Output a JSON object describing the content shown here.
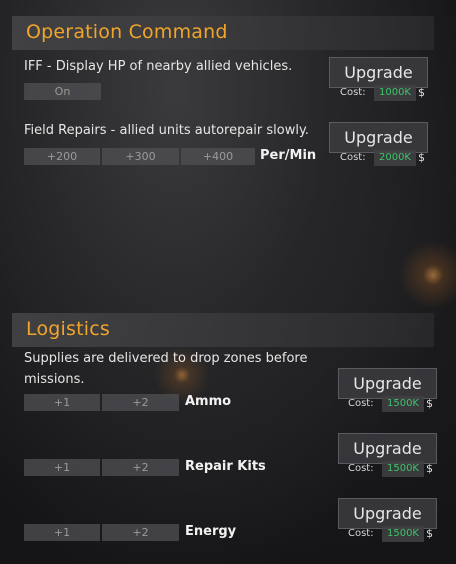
{
  "operation_command": {
    "title": "Operation Command",
    "iff": {
      "description": "IFF - Display HP of nearby allied vehicles.",
      "option": "On",
      "upgrade_label": "Upgrade",
      "cost_label": "Cost:",
      "cost_value": "1000K",
      "currency": "$"
    },
    "field_repairs": {
      "description": "Field Repairs - allied units autorepair slowly.",
      "options": [
        "+200",
        "+300",
        "+400"
      ],
      "unit_label": "Per/Min",
      "upgrade_label": "Upgrade",
      "cost_label": "Cost:",
      "cost_value": "2000K",
      "currency": "$"
    }
  },
  "logistics": {
    "title": "Logistics",
    "description_line1": "Supplies are delivered to drop zones before",
    "description_line2": "missions.",
    "items": [
      {
        "options": [
          "+1",
          "+2"
        ],
        "label": "Ammo",
        "upgrade_label": "Upgrade",
        "cost_label": "Cost:",
        "cost_value": "1500K",
        "currency": "$"
      },
      {
        "options": [
          "+1",
          "+2"
        ],
        "label": "Repair Kits",
        "upgrade_label": "Upgrade",
        "cost_label": "Cost:",
        "cost_value": "1500K",
        "currency": "$"
      },
      {
        "options": [
          "+1",
          "+2"
        ],
        "label": "Energy",
        "upgrade_label": "Upgrade",
        "cost_label": "Cost:",
        "cost_value": "1500K",
        "currency": "$"
      }
    ]
  },
  "colors": {
    "title_accent": "#f0a52a",
    "cost_value": "#3dc46a"
  }
}
